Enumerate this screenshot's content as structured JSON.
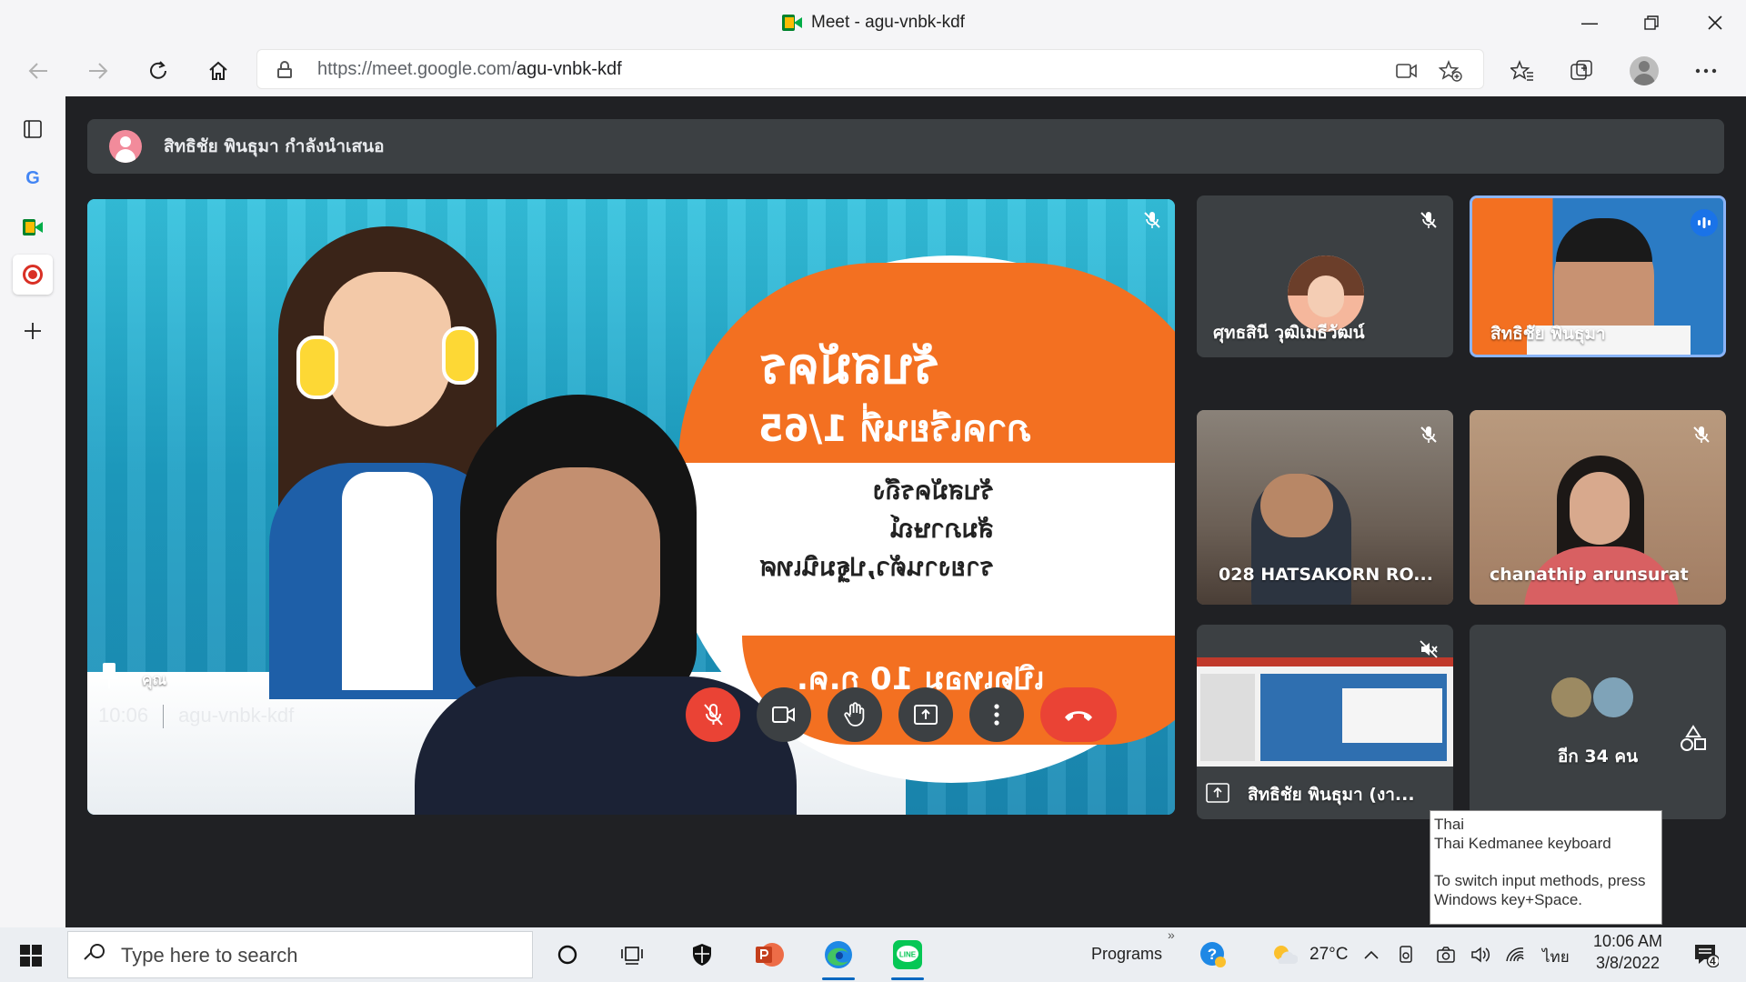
{
  "window": {
    "title": "Meet - agu-vnbk-kdf"
  },
  "address": {
    "url_host": "https://meet.google.com/",
    "url_path": "agu-vnbk-kdf"
  },
  "meet": {
    "presenting_text": "สิทธิชัย พินธุมา กำลังนำเสนอ",
    "self_tile": {
      "label": "คุณ",
      "poster_line1": "รับสมัคร",
      "poster_line2": "ภาคเรียนที่ 1/65",
      "poster_line3": "รับสมัครถึง",
      "poster_line4": "สัมภาษณ์",
      "poster_line5": "รายงานตัว,ปฐมนิเทศ",
      "poster_line6": "เปิดเทอม 10 ก.ค."
    },
    "participants": [
      {
        "name": "ศุทธสินี วุฒิเมธีวัฒน์"
      },
      {
        "name": "สิทธิชัย พินธุมา"
      },
      {
        "name": "028 HATSAKORN RO..."
      },
      {
        "name": "chanathip arunsurat"
      },
      {
        "name": "สิทธิชัย พินธุมา (งา..."
      }
    ],
    "more_count": "อีก 34 คน",
    "clock": "10:06",
    "meeting_code": "agu-vnbk-kdf",
    "colors": {
      "hangup": "#ea4335",
      "mic_off": "#ea4335",
      "control_bg": "#3c4043"
    }
  },
  "tooltip": {
    "line1": "Thai",
    "line2": "Thai Kedmanee keyboard",
    "line3": "To switch input methods, press",
    "line4": "Windows key+Space."
  },
  "taskbar": {
    "search_placeholder": "Type here to search",
    "programs_label": "Programs",
    "weather": "27°C",
    "language": "ไทย",
    "time": "10:06 AM",
    "date": "3/8/2022",
    "notifications": "4"
  }
}
